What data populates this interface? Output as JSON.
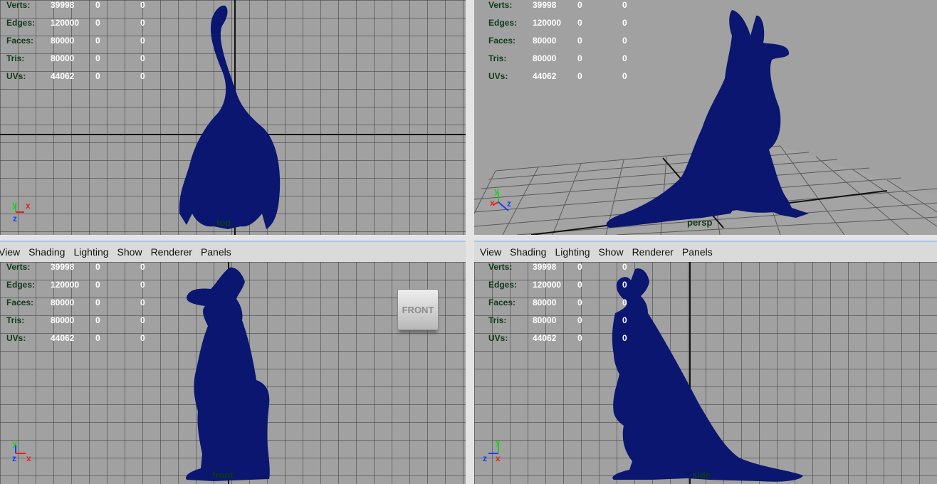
{
  "stats": {
    "labels": [
      "Verts:",
      "Edges:",
      "Faces:",
      "Tris:",
      "UVs:"
    ],
    "rows": [
      {
        "label": "Verts:",
        "v1": "39998",
        "v2": "0",
        "v3": "0"
      },
      {
        "label": "Edges:",
        "v1": "120000",
        "v2": "0",
        "v3": "0"
      },
      {
        "label": "Faces:",
        "v1": "80000",
        "v2": "0",
        "v3": "0"
      },
      {
        "label": "Tris:",
        "v1": "80000",
        "v2": "0",
        "v3": "0"
      },
      {
        "label": "UVs:",
        "v1": "44062",
        "v2": "0",
        "v3": "0"
      }
    ]
  },
  "menu": [
    "View",
    "Shading",
    "Lighting",
    "Show",
    "Renderer",
    "Panels"
  ],
  "viewports": {
    "top": {
      "camera": "top",
      "axes": [
        "y",
        "x"
      ]
    },
    "persp": {
      "camera": "persp",
      "axes": [
        "y",
        "x",
        "z"
      ]
    },
    "front": {
      "camera": "front",
      "axes": [
        "z",
        "x"
      ],
      "view_cube": "FRONT"
    },
    "side": {
      "camera": "side",
      "axes": [
        "y",
        "z",
        "x"
      ]
    }
  },
  "colors": {
    "model": "#0a1670",
    "viewport_bg": "#a1a1a1",
    "grid": "#3a3a3a",
    "hud_label": "#0e3a1a",
    "hud_value": "#ffffff",
    "axis_x": "#e8201a",
    "axis_y": "#22cc22",
    "axis_z": "#1a3cff"
  }
}
